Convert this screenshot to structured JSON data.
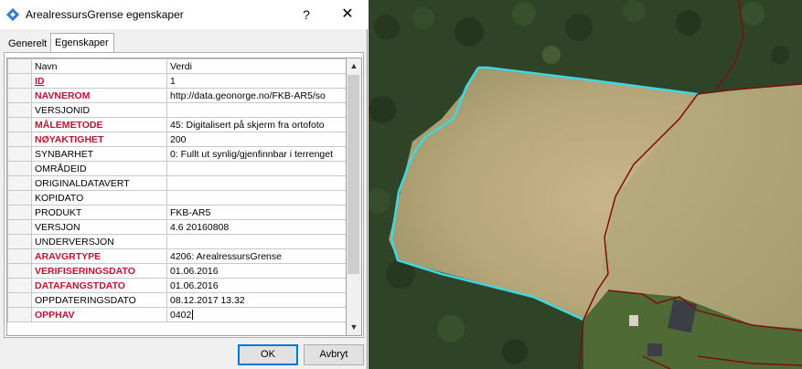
{
  "dialog": {
    "title": "ArealressursGrense egenskaper",
    "help_label": "?",
    "close_label": "✕",
    "tabs": [
      "Generelt",
      "Egenskaper"
    ],
    "active_tab": "Egenskaper",
    "columns": [
      "Navn",
      "Verdi"
    ],
    "rows": [
      {
        "name": "ID",
        "value": "1",
        "required": true,
        "underline": true
      },
      {
        "name": "NAVNEROM",
        "value": "http://data.geonorge.no/FKB-AR5/so",
        "required": true
      },
      {
        "name": "VERSJONID",
        "value": "",
        "required": false
      },
      {
        "name": "MÅLEMETODE",
        "value": "45: Digitalisert på skjerm fra ortofoto",
        "required": true
      },
      {
        "name": "NØYAKTIGHET",
        "value": "200",
        "required": true
      },
      {
        "name": "SYNBARHET",
        "value": "0: Fullt ut synlig/gjenfinnbar i terrenget",
        "required": false
      },
      {
        "name": "OMRÅDEID",
        "value": "",
        "required": false
      },
      {
        "name": "ORIGINALDATAVERT",
        "value": "",
        "required": false
      },
      {
        "name": "KOPIDATO",
        "value": "",
        "required": false
      },
      {
        "name": "PRODUKT",
        "value": "FKB-AR5",
        "required": false
      },
      {
        "name": "VERSJON",
        "value": "4.6 20160808",
        "required": false
      },
      {
        "name": "UNDERVERSJON",
        "value": "",
        "required": false
      },
      {
        "name": "ARAVGRTYPE",
        "value": "4206: ArealressursGrense",
        "required": true
      },
      {
        "name": "VERIFISERINGSDATO",
        "value": "01.06.2016",
        "required": true
      },
      {
        "name": "DATAFANGSTDATO",
        "value": "01.06.2016",
        "required": true
      },
      {
        "name": "OPPDATERINGSDATO",
        "value": "08.12.2017 13.32",
        "required": false
      },
      {
        "name": "OPPHAV",
        "value": "0402",
        "required": true,
        "editing": true
      }
    ],
    "ok_label": "OK",
    "cancel_label": "Avbryt"
  },
  "colors": {
    "required_text": "#c8102e",
    "selected_line": "#3fd6e6",
    "boundary_line": "#7a0f0f"
  }
}
